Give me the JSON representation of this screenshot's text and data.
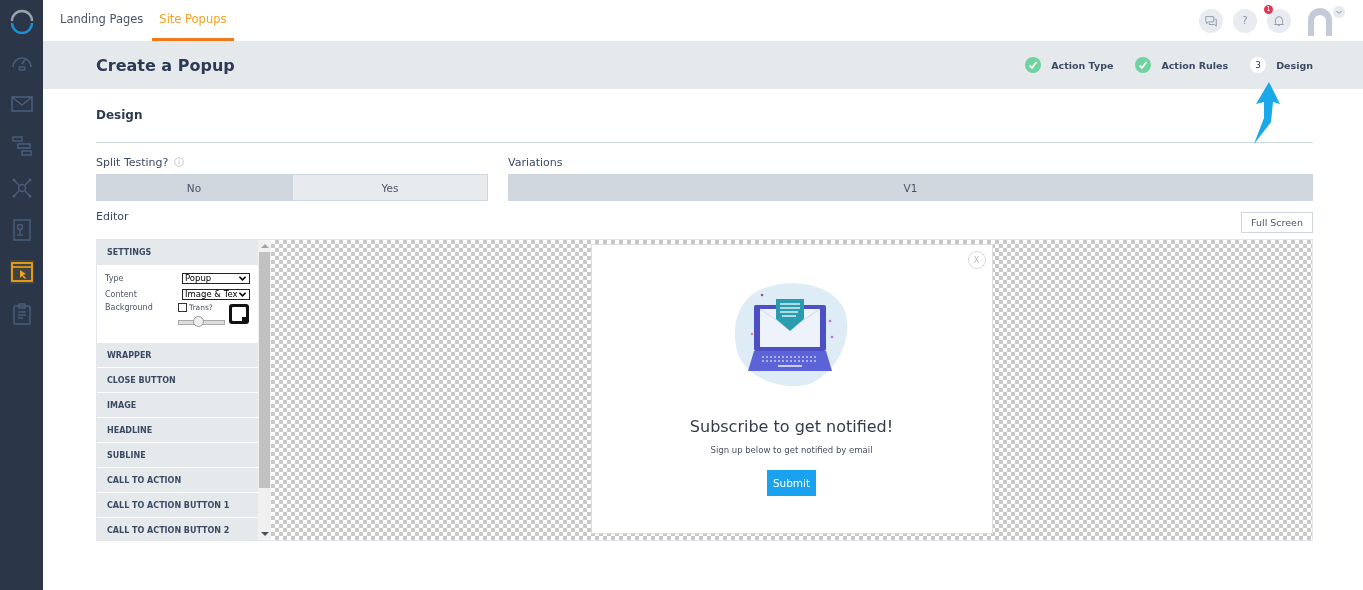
{
  "sidebar": {
    "items": [
      {
        "selected": false
      },
      {
        "selected": false
      },
      {
        "selected": false
      },
      {
        "selected": false
      },
      {
        "selected": false
      },
      {
        "selected": true
      },
      {
        "selected": false
      }
    ]
  },
  "top_tabs": [
    {
      "label": "Landing Pages",
      "selected": false
    },
    {
      "label": "Site Popups",
      "selected": true
    }
  ],
  "top_actions": {
    "help_label": "?",
    "notification_count": "1"
  },
  "header": {
    "title": "Create a Popup",
    "steps": [
      {
        "label": "Action Type",
        "completed": true
      },
      {
        "label": "Action Rules",
        "completed": true
      },
      {
        "marker": "3",
        "label": "Design",
        "completed": false
      }
    ]
  },
  "section_title": "Design",
  "split_testing": {
    "label": "Split Testing?",
    "options": [
      {
        "label": "No",
        "selected": true
      },
      {
        "label": "Yes",
        "selected": false
      }
    ]
  },
  "variations": {
    "label": "Variations",
    "options": [
      {
        "label": "V1",
        "selected": true
      }
    ]
  },
  "editor": {
    "label": "Editor",
    "full_screen_button": "Full Screen",
    "sections": [
      {
        "label": "SETTINGS",
        "expanded": true
      },
      {
        "label": "WRAPPER",
        "expanded": false
      },
      {
        "label": "CLOSE BUTTON",
        "expanded": false
      },
      {
        "label": "IMAGE",
        "expanded": false
      },
      {
        "label": "HEADLINE",
        "expanded": false
      },
      {
        "label": "SUBLINE",
        "expanded": false
      },
      {
        "label": "CALL TO ACTION",
        "expanded": false
      },
      {
        "label": "CALL TO ACTION BUTTON 1",
        "expanded": false
      },
      {
        "label": "CALL TO ACTION BUTTON 2",
        "expanded": false
      }
    ],
    "settings": {
      "type_label": "Type",
      "type_value": "Popup",
      "content_label": "Content",
      "content_value": "Image & Tex",
      "background_label": "Background",
      "transparent_label": "Trans?",
      "transparent_checked": false,
      "opacity": {
        "level": 0.45
      }
    },
    "popup": {
      "close_label": "X",
      "headline": "Subscribe to get notified!",
      "subline": "Sign up below to get notified by email",
      "button": "Submit"
    }
  }
}
